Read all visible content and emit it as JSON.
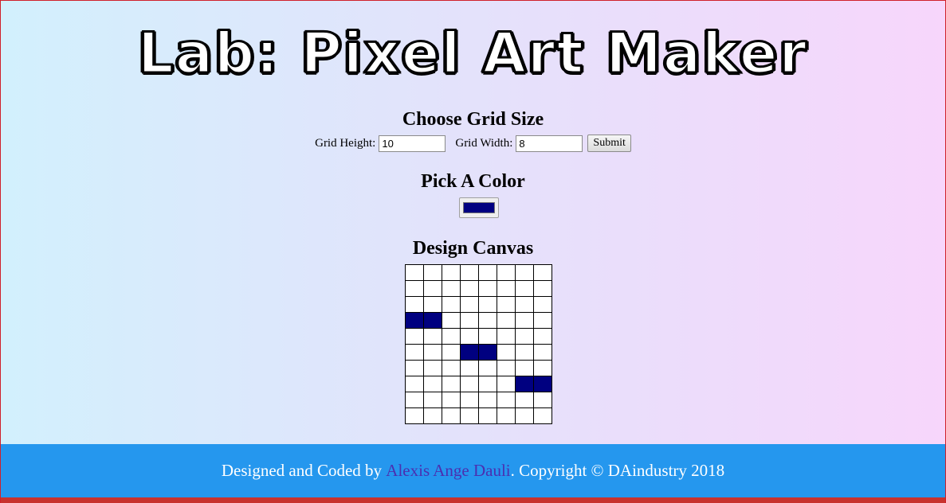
{
  "header": {
    "title": "Lab: Pixel Art Maker"
  },
  "grid_size": {
    "heading": "Choose Grid Size",
    "height_label": "Grid Height:",
    "height_value": "10",
    "width_label": "Grid Width:",
    "width_value": "8",
    "submit_label": "Submit"
  },
  "color": {
    "heading": "Pick A Color",
    "value": "#000080"
  },
  "canvas": {
    "heading": "Design Canvas",
    "rows": 10,
    "cols": 8,
    "filled_color": "#000080",
    "filled": [
      [
        3,
        0
      ],
      [
        3,
        1
      ],
      [
        5,
        3
      ],
      [
        5,
        4
      ],
      [
        7,
        6
      ],
      [
        7,
        7
      ]
    ]
  },
  "footer": {
    "prefix": "Designed and Coded by ",
    "author": "Alexis Ange Dauli",
    "suffix": ". Copyright © DAindustry 2018"
  }
}
